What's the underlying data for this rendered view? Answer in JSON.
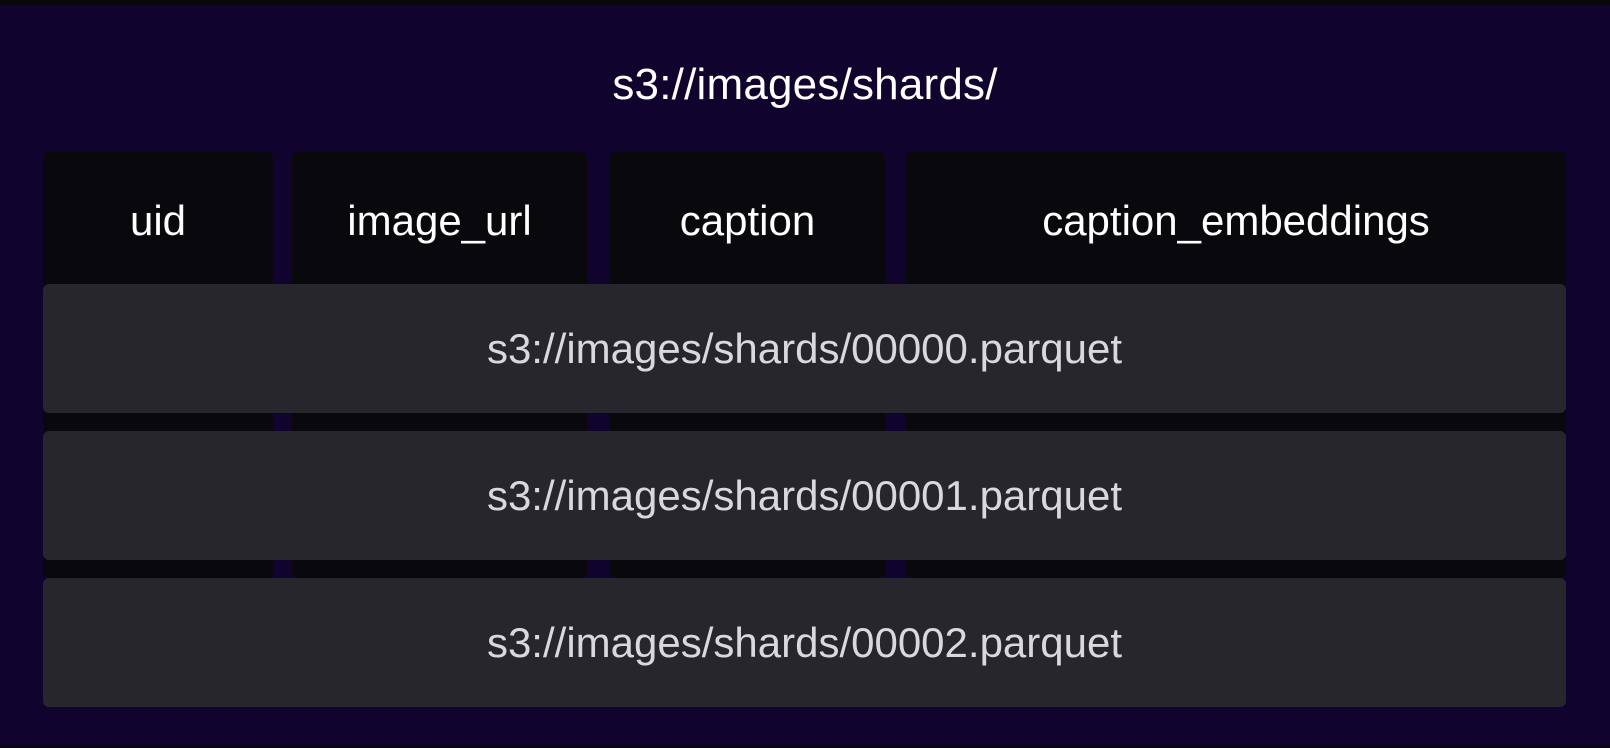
{
  "title": "s3://images/shards/",
  "columns": [
    {
      "label": "uid"
    },
    {
      "label": "image_url"
    },
    {
      "label": "caption"
    },
    {
      "label": "caption_embeddings"
    }
  ],
  "shards": [
    {
      "label": "s3://images/shards/00000.parquet"
    },
    {
      "label": "s3://images/shards/00001.parquet"
    },
    {
      "label": "s3://images/shards/00002.parquet"
    }
  ],
  "colors": {
    "background": "#10042f",
    "column_fill": "#09080d",
    "shard_fill": "#27262c",
    "text": "#ffffff",
    "shard_text": "#d9d8de"
  }
}
